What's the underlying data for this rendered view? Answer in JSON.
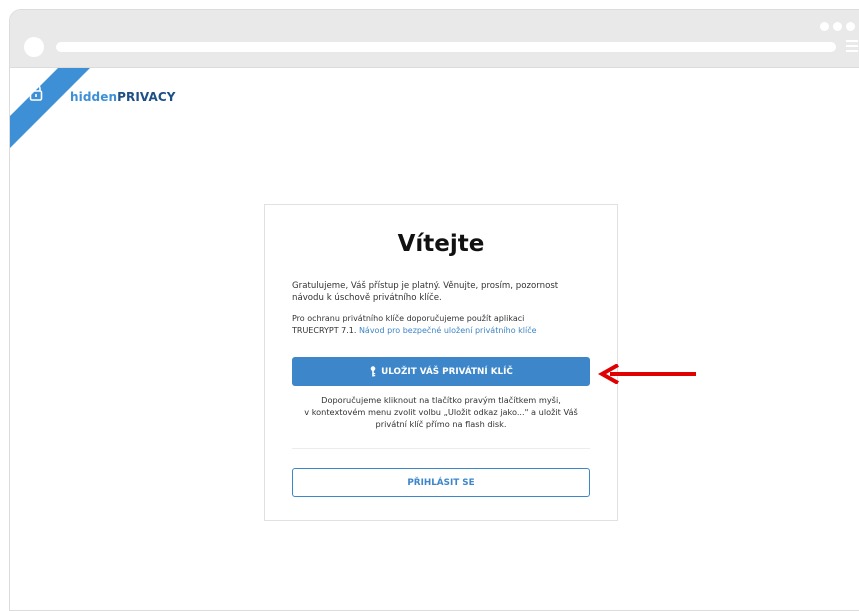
{
  "brand": {
    "name_part1": "hidden",
    "name_part2": "PRIVACY"
  },
  "welcome": {
    "title": "Vítejte",
    "intro_line1": "Gratulujeme, Váš přístup je platný. Věnujte, prosím, pozornost",
    "intro_line2": "návodu k úschově privátního klíče.",
    "protect_line1": "Pro ochranu privátního klíče doporučujeme použít aplikaci",
    "protect_line2_prefix": "TRUECRYPT 7.1. ",
    "guide_link": "Návod pro bezpečné uložení privátního klíče",
    "save_button": "ULOŽIT VÁŠ PRIVÁTNÍ KLÍČ",
    "note_line1": "Doporučujeme kliknout na tlačítko pravým tlačítkem myši,",
    "note_line2": "v kontextovém menu zvolit volbu „Uložit odkaz jako...\" a uložit Váš",
    "note_line3": "privátní klíč přímo na flash disk.",
    "login_button": "PŘIHLÁSIT SE"
  },
  "colors": {
    "accent": "#3c86c9",
    "ribbon": "#3d8fd6",
    "brand_dark": "#1e4f86",
    "annotation_arrow": "#e00000"
  },
  "icons": {
    "lock": "lock-icon",
    "key": "key-icon",
    "arrow": "arrow-left-icon"
  }
}
